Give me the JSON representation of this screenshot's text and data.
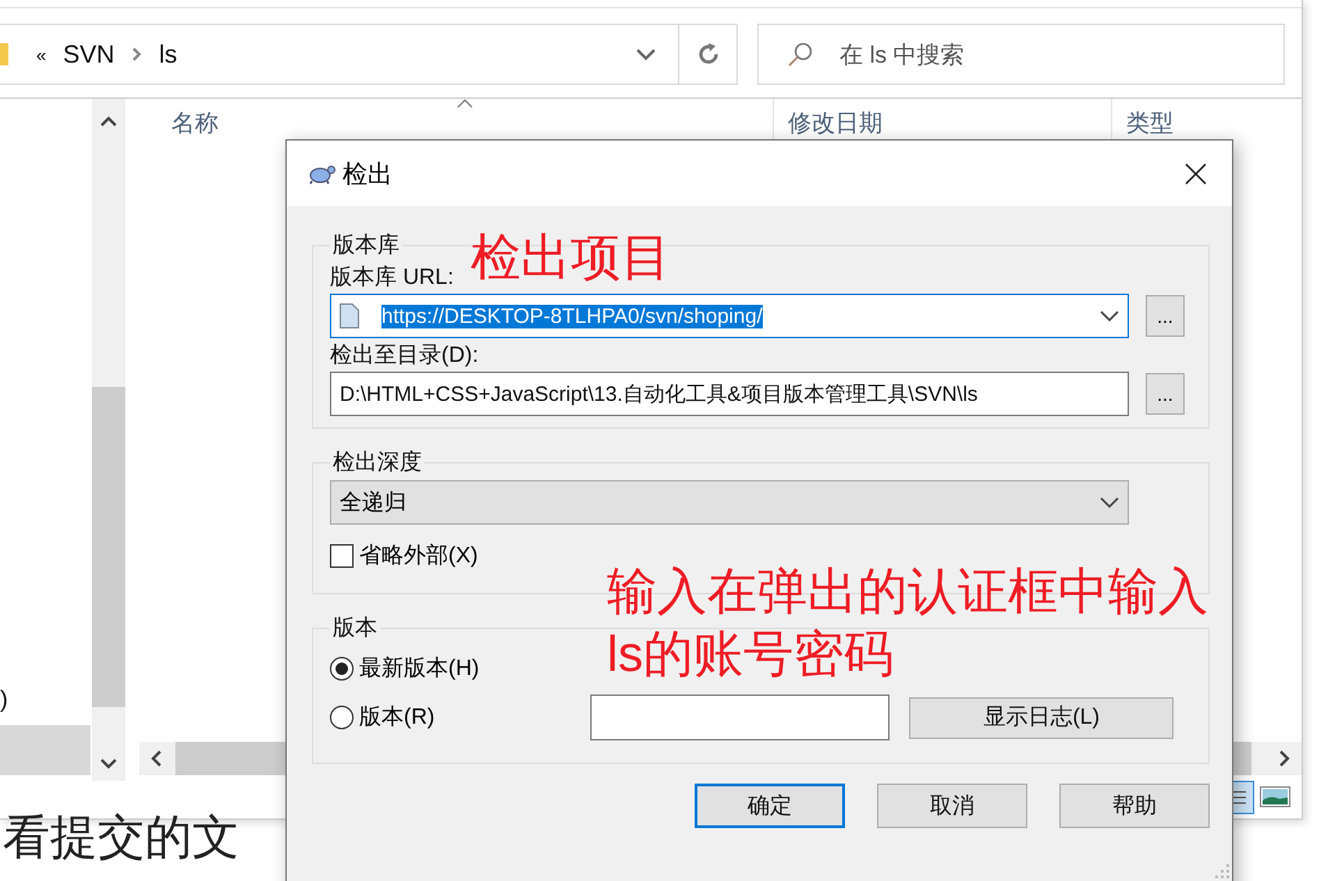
{
  "explorer": {
    "address": {
      "overflow": "«",
      "path": [
        {
          "label": "SVN"
        },
        {
          "label": "ls"
        }
      ]
    },
    "search": {
      "placeholder": "在 ls 中搜索"
    },
    "nav_items": [
      {
        "label": ")",
        "selected": false
      },
      {
        "selected": true
      }
    ],
    "columns": [
      {
        "label": "名称",
        "sorted": true
      },
      {
        "label": "修改日期",
        "sorted": false
      },
      {
        "label": "类型",
        "sorted": false
      }
    ]
  },
  "background_text": "看提交的文",
  "dialog": {
    "title": "检出",
    "repository": {
      "legend": "版本库",
      "url_label": "版本库 URL:",
      "url": "https://DESKTOP-8TLHPA0/svn/shoping/",
      "url_selected": true,
      "url_browse": "...",
      "dir_label": "检出至目录(D):",
      "dir": "D:\\HTML+CSS+JavaScript\\13.自动化工具&项目版本管理工具\\SVN\\ls",
      "dir_browse": "..."
    },
    "depth": {
      "legend": "检出深度",
      "value": "全递归",
      "omit_externals": {
        "label": "省略外部(X)",
        "checked": false
      }
    },
    "revision": {
      "legend": "版本",
      "options": [
        {
          "label": "最新版本(H)",
          "selected": true
        },
        {
          "label": "版本(R)",
          "selected": false
        }
      ],
      "show_log": "显示日志(L)"
    },
    "buttons": [
      {
        "label": "确定",
        "default": true
      },
      {
        "label": "取消",
        "default": false
      },
      {
        "label": "帮助",
        "default": false
      }
    ]
  },
  "annotations": [
    {
      "kind": "title",
      "text": "检出项目"
    },
    {
      "kind": "note",
      "text": "输入在弹出的认证框中输入\nls的账号密码"
    }
  ]
}
